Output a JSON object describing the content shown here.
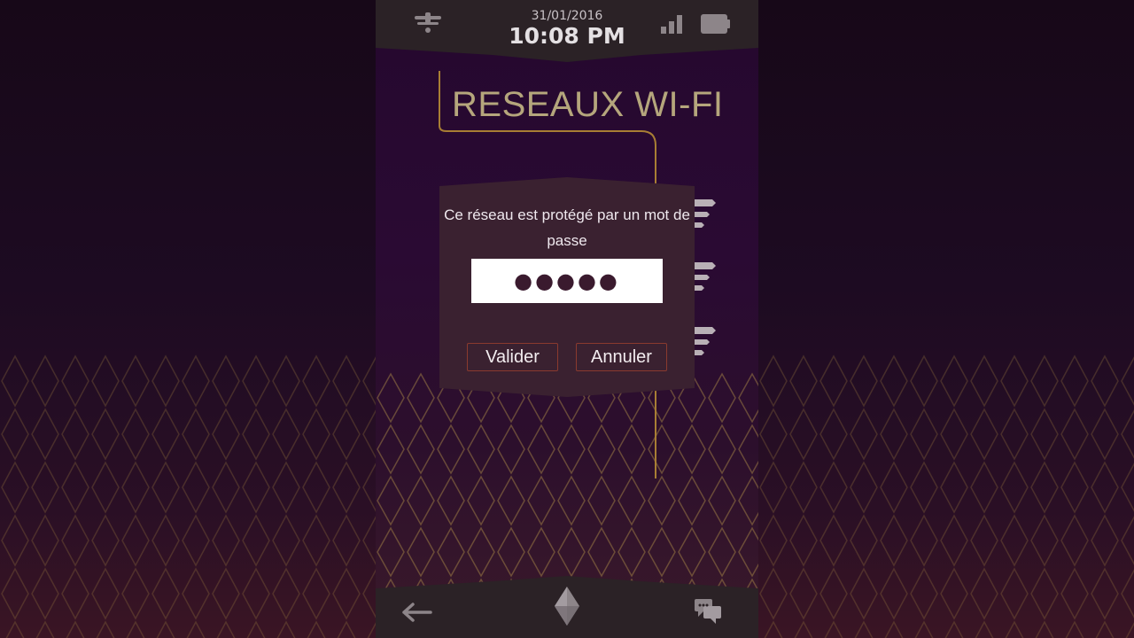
{
  "status_bar": {
    "date": "31/01/2016",
    "time": "10:08 PM",
    "icons": [
      "notification-icon",
      "signal-icon",
      "battery-icon"
    ]
  },
  "screen": {
    "title": "RESEAUX WI-FI"
  },
  "dialog": {
    "message": "Ce réseau est protégé par un mot de passe",
    "password_value": "●●●●●",
    "confirm_label": "Valider",
    "cancel_label": "Annuler"
  },
  "bottom_bar": {
    "icons": [
      "back-arrow-icon",
      "home-diamond-icon",
      "chat-icon"
    ]
  },
  "colors": {
    "title": "#b5a67c",
    "circuit": "#a87e34",
    "dialog_bg": "#3a2130",
    "button_border": "#8a3a2e"
  }
}
